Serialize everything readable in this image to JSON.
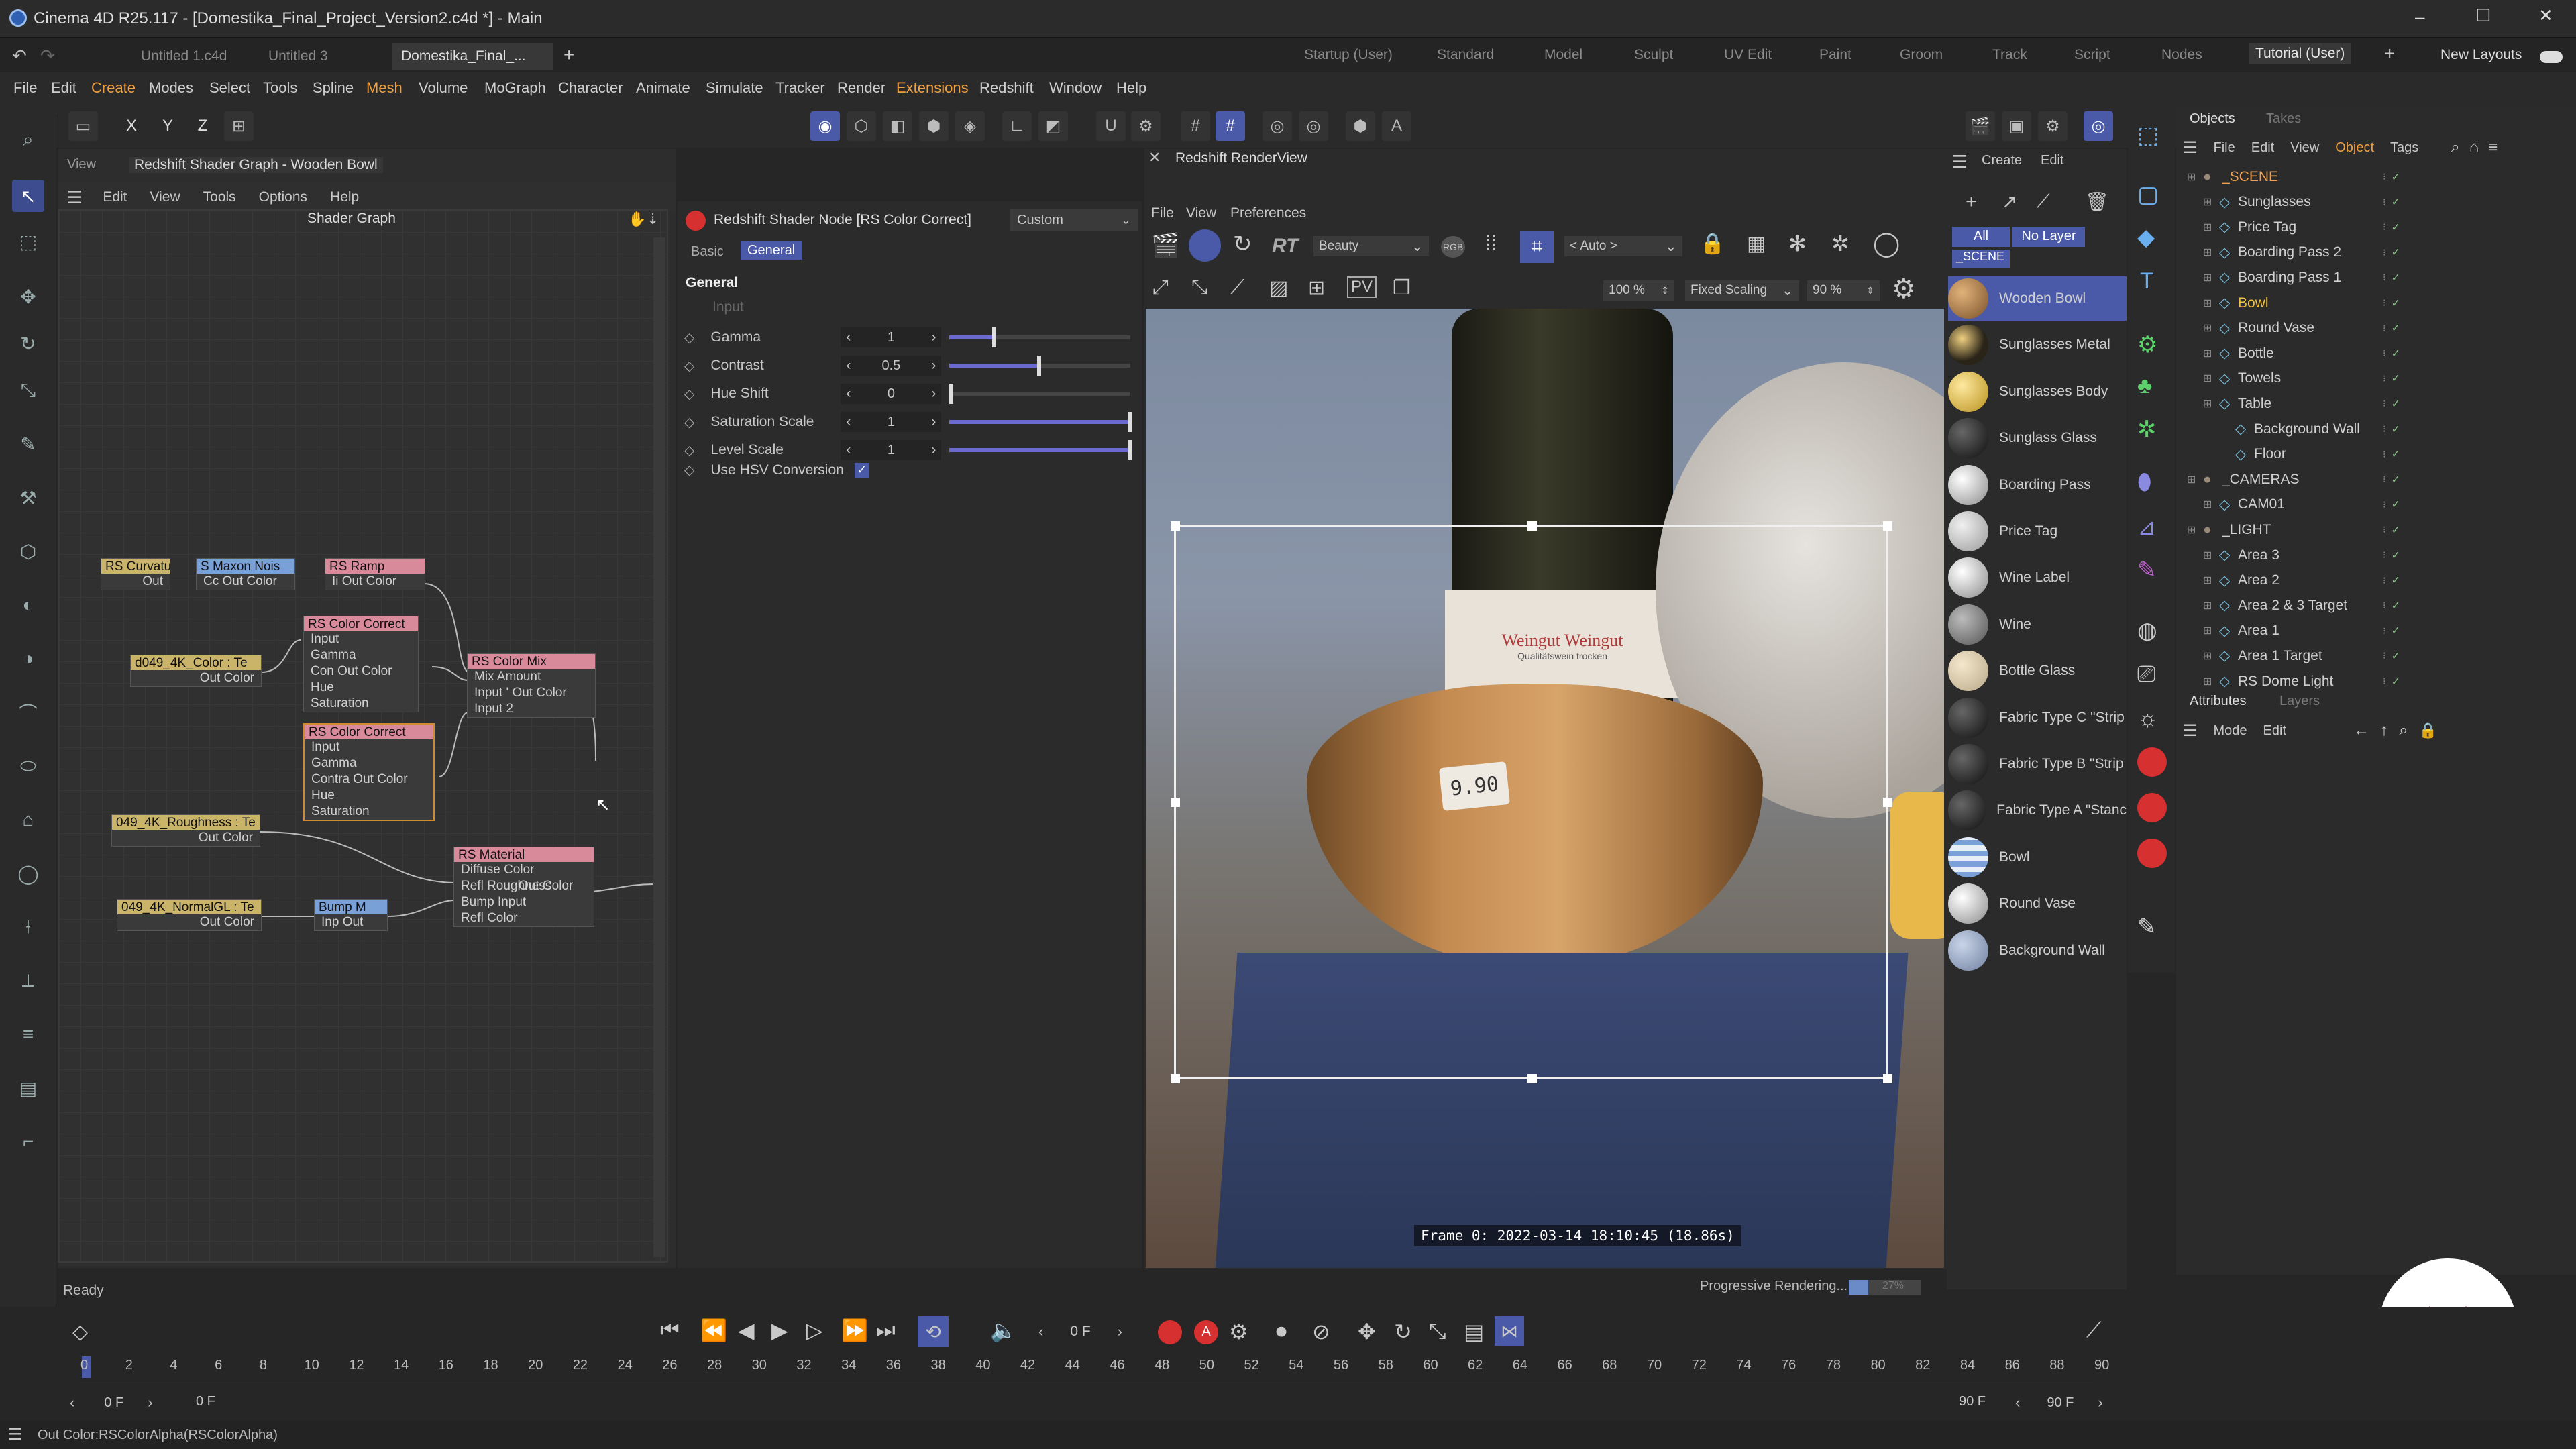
{
  "window": {
    "title": "Cinema 4D R25.117 - [Domestika_Final_Project_Version2.c4d *] - Main",
    "controls": [
      "–",
      "☐",
      "✕"
    ]
  },
  "doc_tabs": [
    "Untitled 1.c4d",
    "Untitled 3",
    "Domestika_Final_..."
  ],
  "add_tab": "+",
  "layouts": [
    "Startup (User)",
    "Standard",
    "Model",
    "Sculpt",
    "UV Edit",
    "Paint",
    "Groom",
    "Track",
    "Script",
    "Nodes",
    "Tutorial (User)"
  ],
  "new_layouts": "New Layouts",
  "main_menu": [
    "File",
    "Edit",
    "Create",
    "Modes",
    "Select",
    "Tools",
    "Spline",
    "Mesh",
    "Volume",
    "MoGraph",
    "Character",
    "Animate",
    "Simulate",
    "Tracker",
    "Render",
    "Extensions",
    "Redshift",
    "Window",
    "Help"
  ],
  "axis_buttons": [
    "X",
    "Y",
    "Z"
  ],
  "shader_graph": {
    "window_tab": "View",
    "title": "Redshift Shader Graph - Wooden Bowl",
    "menu": [
      "Edit",
      "View",
      "Tools",
      "Options",
      "Help"
    ],
    "canvas_title": "Shader Graph",
    "nodes": [
      {
        "title": "RS Curvatu",
        "ports": [
          "Out"
        ]
      },
      {
        "title": "S Maxon Nois",
        "ports": [
          "Cc Out Color"
        ]
      },
      {
        "title": "RS Ramp",
        "ports": [
          "Ii Out Color"
        ]
      },
      {
        "title": "d049_4K_Color : Te",
        "ports": [
          "Out Color"
        ]
      },
      {
        "title": "RS Color Correct",
        "ports": [
          "Input",
          "Gamma",
          "Con Out Color",
          "Hue",
          "Saturation"
        ]
      },
      {
        "title": "RS Color Mix",
        "ports": [
          "Mix Amount",
          "Input ' Out Color",
          "Input 2"
        ]
      },
      {
        "title": "RS Color Correct",
        "ports": [
          "Input",
          "Gamma",
          "Contra Out Color",
          "Hue",
          "Saturation"
        ]
      },
      {
        "title": "049_4K_Roughness : Te",
        "ports": [
          "Out Color"
        ]
      },
      {
        "title": "RS Material",
        "ports": [
          "Diffuse Color",
          "Refl Roughness",
          "Bump Input",
          "Refl Color"
        ],
        "out": "Out Color"
      },
      {
        "title": "049_4K_NormalGL : Te",
        "ports": [
          "Out Color"
        ]
      },
      {
        "title": "Bump M",
        "ports": [
          "Inp Out"
        ]
      }
    ],
    "status": "Ready"
  },
  "attributes": {
    "node_title": "Redshift Shader Node [RS Color Correct]",
    "preset": "Custom",
    "tabs": [
      "Basic",
      "General"
    ],
    "section": "General",
    "input_label": "Input",
    "params": [
      {
        "label": "Gamma",
        "value": "1",
        "slider": 0.25
      },
      {
        "label": "Contrast",
        "value": "0.5",
        "slider": 0.5
      },
      {
        "label": "Hue Shift",
        "value": "0",
        "slider": 0.0
      },
      {
        "label": "Saturation Scale",
        "value": "1",
        "slider": 1.0
      },
      {
        "label": "Level Scale",
        "value": "1",
        "slider": 1.0
      }
    ],
    "checkbox_label": "Use HSV Conversion",
    "checkbox_checked": true
  },
  "renderview": {
    "title": "Redshift RenderView",
    "menu": [
      "File",
      "View",
      "Preferences"
    ],
    "rt_label": "RT",
    "aov": "Beauty",
    "rgb": "RGB",
    "camera": "< Auto >",
    "zoom": "100 %",
    "scaling": "Fixed Scaling",
    "scale_pct": "90 %",
    "bottle_label": "Weingut Weingut",
    "bottle_sub": "Qualitätswein trocken",
    "price_tag": "9.90",
    "frame_info": "Frame  0: 2022-03-14  18:10:45  (18.86s)",
    "progress_label": "Progressive Rendering...",
    "progress_pct": "27%",
    "progress_value": 0.27
  },
  "materials": {
    "filters": [
      "All",
      "No Layer"
    ],
    "scene_label": "_SCENE",
    "items": [
      {
        "name": "Wooden Bowl",
        "selected": true,
        "ball": "wood"
      },
      {
        "name": "Sunglasses Metal",
        "ball": "gold-dark"
      },
      {
        "name": "Sunglasses Body",
        "ball": "gold"
      },
      {
        "name": "Sunglass Glass",
        "ball": "black"
      },
      {
        "name": "Boarding Pass",
        "ball": "white"
      },
      {
        "name": "Price Tag",
        "ball": "tag"
      },
      {
        "name": "Wine Label",
        "ball": "white"
      },
      {
        "name": "Wine",
        "ball": "grey-checker"
      },
      {
        "name": "Bottle Glass",
        "ball": "cream"
      },
      {
        "name": "Fabric Type C \"Strip",
        "ball": "black"
      },
      {
        "name": "Fabric Type B \"Strip",
        "ball": "black"
      },
      {
        "name": "Fabric Type A \"Stanc",
        "ball": "black"
      },
      {
        "name": "Bowl",
        "ball": "blue-stripe"
      },
      {
        "name": "Round Vase",
        "ball": "white"
      },
      {
        "name": "Background Wall",
        "ball": "blue-grey"
      }
    ]
  },
  "objects": {
    "tabs": [
      "Objects",
      "Takes"
    ],
    "menu": [
      "File",
      "Edit",
      "View",
      "Object",
      "Tags"
    ],
    "rows": [
      {
        "name": "_SCENE",
        "level": 0,
        "color": "#e8a0b0",
        "text_color": "#f0a050"
      },
      {
        "name": "Sunglasses",
        "level": 1
      },
      {
        "name": "Price Tag",
        "level": 1
      },
      {
        "name": "Boarding Pass 2",
        "level": 1
      },
      {
        "name": "Boarding Pass 1",
        "level": 1
      },
      {
        "name": "Bowl",
        "level": 1,
        "text_color": "#f0c040"
      },
      {
        "name": "Round Vase",
        "level": 1
      },
      {
        "name": "Bottle",
        "level": 1
      },
      {
        "name": "Towels",
        "level": 1
      },
      {
        "name": "Table",
        "level": 1
      },
      {
        "name": "Background Wall",
        "level": 2
      },
      {
        "name": "Floor",
        "level": 2
      },
      {
        "name": "_CAMERAS",
        "level": 0
      },
      {
        "name": "CAM01",
        "level": 1
      },
      {
        "name": "_LIGHT",
        "level": 0
      },
      {
        "name": "Area 3",
        "level": 1
      },
      {
        "name": "Area 2",
        "level": 1
      },
      {
        "name": "Area 2 & 3 Target",
        "level": 1
      },
      {
        "name": "Area 1",
        "level": 1
      },
      {
        "name": "Area 1 Target",
        "level": 1
      },
      {
        "name": "RS Dome Light",
        "level": 1
      }
    ]
  },
  "attr_panel": {
    "tabs": [
      "Attributes",
      "Layers"
    ],
    "menu": [
      "Mode",
      "Edit"
    ]
  },
  "timeline": {
    "current_frame": "0 F",
    "ticks": [
      "0",
      "2",
      "4",
      "6",
      "8",
      "10",
      "12",
      "14",
      "16",
      "18",
      "20",
      "22",
      "24",
      "26",
      "28",
      "30",
      "32",
      "34",
      "36",
      "38",
      "40",
      "42",
      "44",
      "46",
      "48",
      "50",
      "52",
      "54",
      "56",
      "58",
      "60",
      "62",
      "64",
      "66",
      "68",
      "70",
      "72",
      "74",
      "76",
      "78",
      "80",
      "82",
      "84",
      "86",
      "88",
      "90"
    ],
    "start": "0 F",
    "start2": "0 F",
    "end": "90 F",
    "end2": "90 F"
  },
  "statusbar": "Out Color:RSColorAlpha(RSColorAlpha)"
}
